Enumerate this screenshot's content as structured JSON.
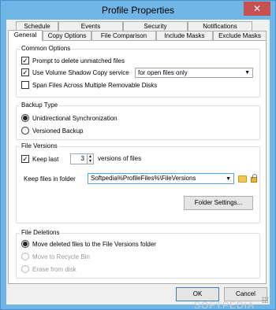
{
  "window": {
    "title": "Profile Properties",
    "close_glyph": "✕"
  },
  "tabs_back": [
    {
      "label": "Schedule"
    },
    {
      "label": "Events"
    },
    {
      "label": "Security"
    },
    {
      "label": "Notifications"
    }
  ],
  "tabs_front": [
    {
      "label": "General"
    },
    {
      "label": "Copy Options"
    },
    {
      "label": "File Comparison"
    },
    {
      "label": "Include Masks"
    },
    {
      "label": "Exclude Masks"
    }
  ],
  "common_options": {
    "title": "Common Options",
    "prompt_delete": {
      "label": "Prompt to delete unmatched files",
      "checked": true
    },
    "vss": {
      "label": "Use Volume Shadow Copy service",
      "checked": true
    },
    "vss_select": {
      "value": "for open files only",
      "arrow": "▼"
    },
    "span": {
      "label": "Span Files Across Multiple Removable Disks",
      "checked": false
    },
    "check_glyph": "✓"
  },
  "backup_type": {
    "title": "Backup Type",
    "options": [
      {
        "label": "Unidirectional Synchronization",
        "selected": true
      },
      {
        "label": "Versioned Backup",
        "selected": false
      }
    ]
  },
  "file_versions": {
    "title": "File Versions",
    "keep_last_label": "Keep last",
    "keep_last_checked": true,
    "keep_count": "3",
    "spin_up": "▲",
    "spin_down": "▼",
    "versions_suffix": "versions of files",
    "folder_label": "Keep files in folder",
    "folder_value": "Softpedia%ProfileFiles%\\FileVersions",
    "folder_arrow": "▼",
    "folder_settings_button": "Folder Settings..."
  },
  "file_deletions": {
    "title": "File Deletions",
    "options": [
      {
        "label": "Move deleted files to the File Versions folder",
        "selected": true,
        "disabled": false
      },
      {
        "label": "Move to Recycle Bin",
        "selected": false,
        "disabled": true
      },
      {
        "label": "Erase from disk",
        "selected": false,
        "disabled": true
      }
    ]
  },
  "footer": {
    "ok": "OK",
    "cancel": "Cancel"
  },
  "watermark": "SOFTPEDIA"
}
